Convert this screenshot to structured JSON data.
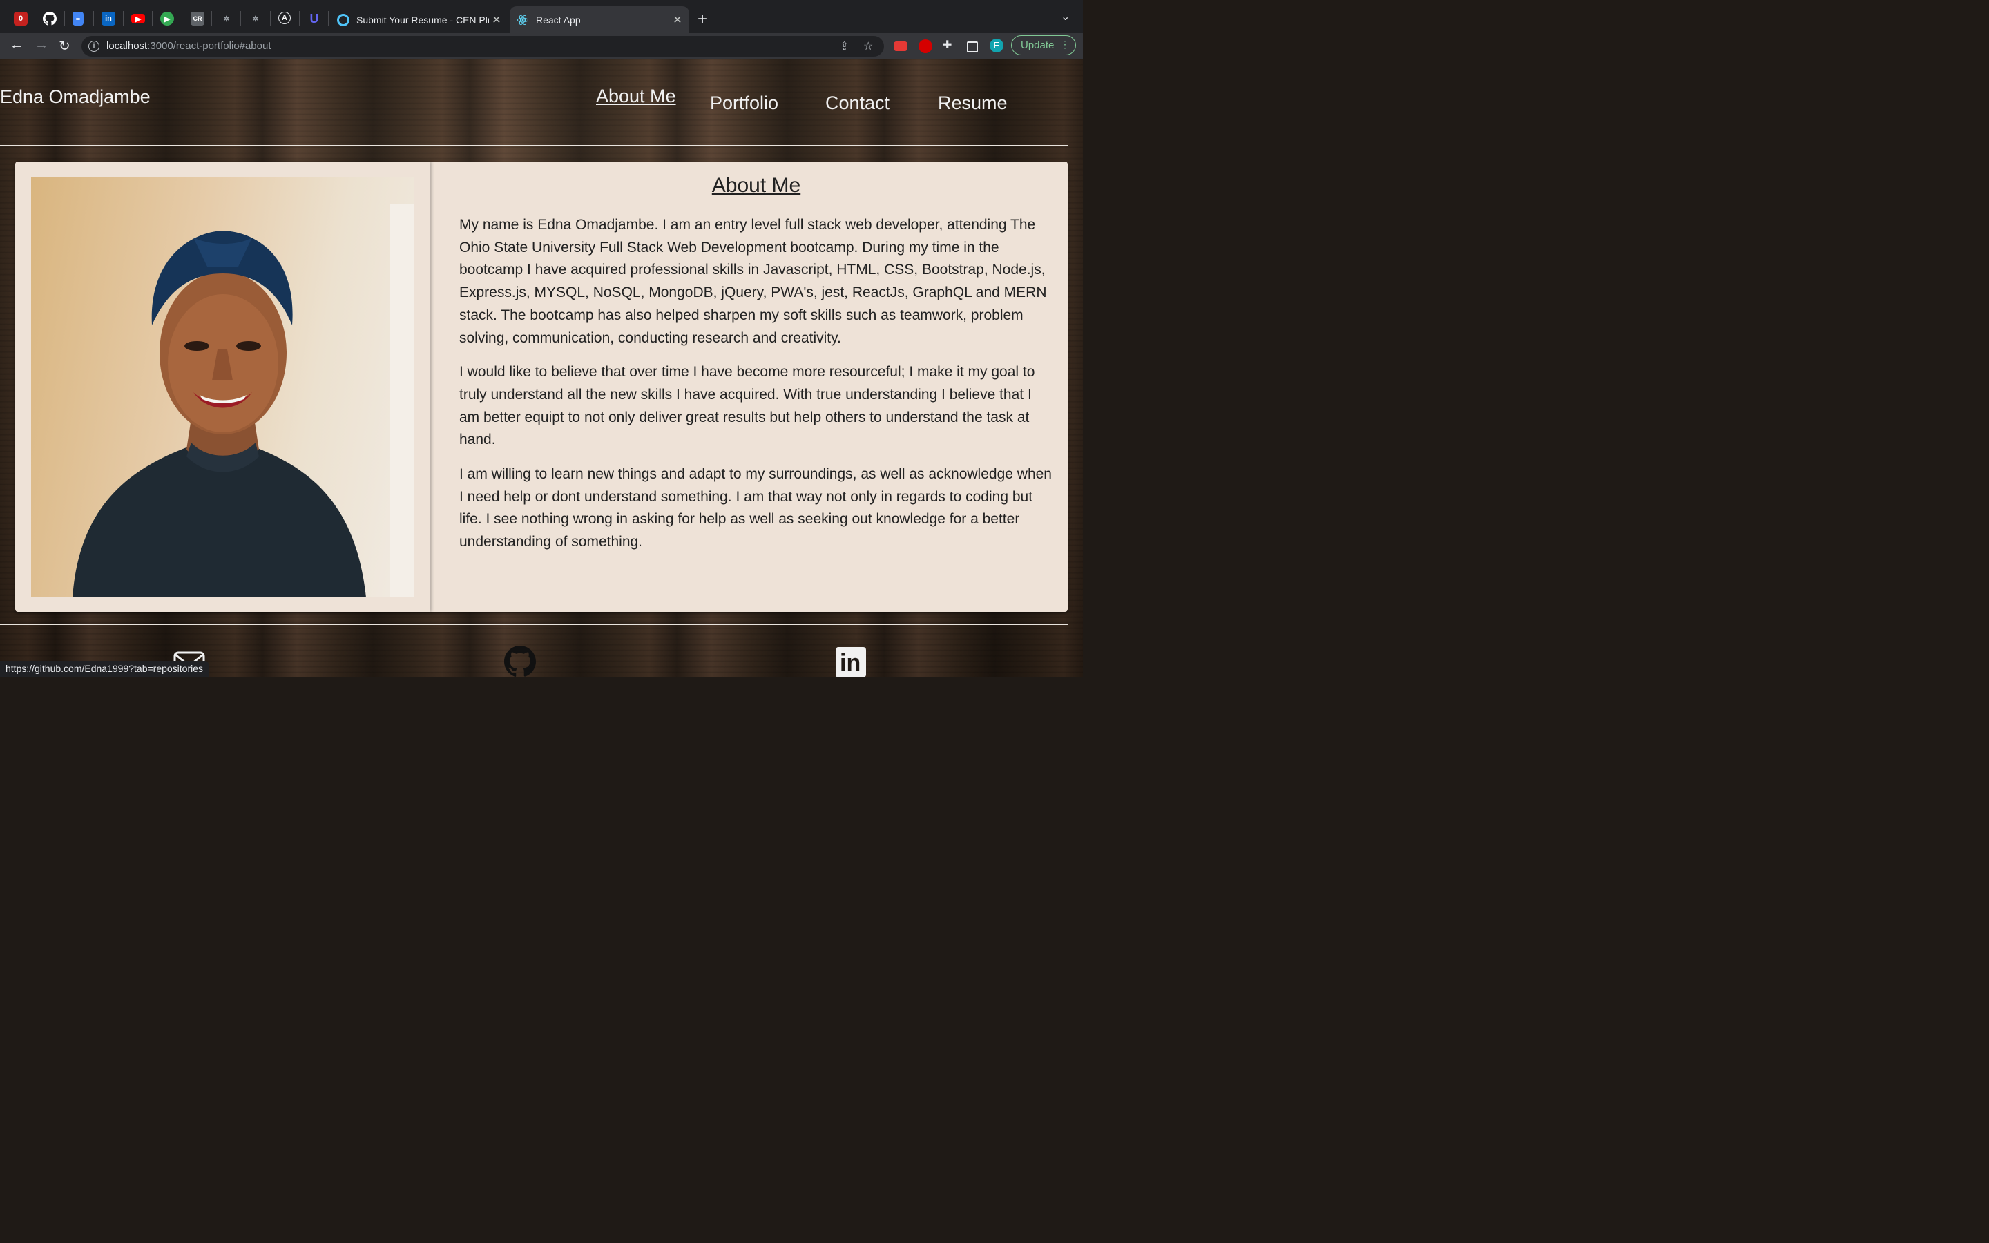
{
  "browser": {
    "pinned_tabs": [
      {
        "icon": "gmail-icon",
        "color": "#d93025"
      },
      {
        "icon": "github-icon",
        "color": "#ffffff"
      },
      {
        "icon": "docs-icon",
        "color": "#4285f4"
      },
      {
        "icon": "linkedin-icon",
        "color": "#0a66c2"
      },
      {
        "icon": "youtube-icon",
        "color": "#ff0000"
      },
      {
        "icon": "play-icon",
        "color": "#34a853"
      },
      {
        "icon": "cr-icon",
        "color": "#5f6368"
      },
      {
        "icon": "openai-icon",
        "color": "#9aa0a6"
      },
      {
        "icon": "openai-icon",
        "color": "#9aa0a6"
      },
      {
        "icon": "a-circle-icon",
        "color": "#e8eaed"
      },
      {
        "icon": "u-icon",
        "color": "#4f46e5"
      }
    ],
    "tabs": [
      {
        "label": "Submit Your Resume - CEN Plu",
        "active": false
      },
      {
        "label": "React App",
        "active": true
      }
    ],
    "address": {
      "host": "localhost",
      "path": ":3000/react-portfolio#about"
    },
    "update_label": "Update",
    "profile_initial": "E",
    "status_url": "https://github.com/Edna1999?tab=repositories"
  },
  "site": {
    "brand": "Edna Omadjambe",
    "nav": [
      "About Me",
      "Portfolio",
      "Contact",
      "Resume"
    ],
    "active_nav": "About Me"
  },
  "about": {
    "title": "About Me",
    "paragraphs": [
      "My name is Edna Omadjambe. I am an entry level full stack web developer, attending The Ohio State University Full Stack Web Development bootcamp. During my time in the bootcamp I have acquired professional skills in Javascript, HTML, CSS, Bootstrap, Node.js, Express.js, MYSQL, NoSQL, MongoDB, jQuery, PWA's, jest, ReactJs, GraphQL and MERN stack. The bootcamp has also helped sharpen my soft skills such as teamwork, problem solving, communication, conducting research and creativity.",
      "I would like to believe that over time I have become more resourceful; I make it my goal to truly understand all the new skills I have acquired. With true understanding I believe that I am better equipt to not only deliver great results but help others to understand the task at hand.",
      "I am willing to learn new things and adapt to my surroundings, as well as acknowledge when I need help or dont understand something. I am that way not only in regards to coding but life. I see nothing wrong in asking for help as well as seeking out knowledge for a better understanding of something."
    ]
  },
  "footer": {
    "icons": [
      "email-icon",
      "github-icon",
      "linkedin-icon"
    ]
  }
}
